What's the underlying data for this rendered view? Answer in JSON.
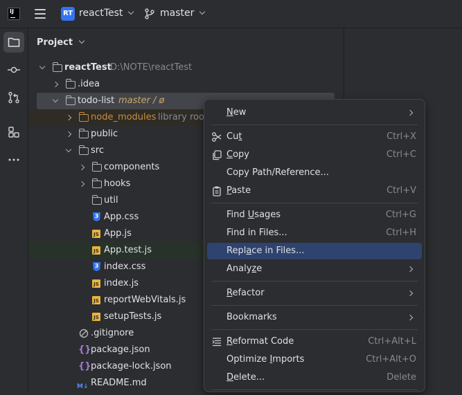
{
  "titlebar": {
    "logo": "IJ",
    "project_badge": "RT",
    "project_name": "reactTest",
    "branch": "master",
    "icons": [
      "intellij-logo-icon",
      "hamburger-menu-icon",
      "branch-icon",
      "chevron-down-icon"
    ]
  },
  "left_strip": {
    "icons": [
      "folder-icon",
      "commit-icon",
      "pull-request-icon",
      "structure-icon",
      "more-icon"
    ]
  },
  "panel": {
    "title": "Project"
  },
  "tree": {
    "root_name": "reactTest",
    "root_path": "D:\\NOTE\\reactTest",
    "idea": ".idea",
    "todo_list": "todo-list",
    "todo_branch": "master / ø",
    "node_modules": "node_modules",
    "node_modules_hint": "library root",
    "public": "public",
    "src": "src",
    "components": "components",
    "hooks": "hooks",
    "util": "util",
    "app_css": "App.css",
    "app_js": "App.js",
    "app_test_js": "App.test.js",
    "index_css": "index.css",
    "index_js": "index.js",
    "report_web_vitals": "reportWebVitals.js",
    "setup_tests": "setupTests.js",
    "gitignore": ".gitignore",
    "package_json": "package.json",
    "package_lock": "package-lock.json",
    "readme": "README.md",
    "badge_js": "JS",
    "badge_css": "3",
    "badge_md": "M↓",
    "badge_json": "{}"
  },
  "context_menu": {
    "new_a": "N",
    "new_b": "ew",
    "cut_a": "Cu",
    "cut_b": "t",
    "cut_shortcut": "Ctrl+X",
    "copy_a": "C",
    "copy_b": "opy",
    "copy_shortcut": "Ctrl+C",
    "copy_path": "Copy Path/Reference...",
    "paste_a": "P",
    "paste_b": "aste",
    "paste_shortcut": "Ctrl+V",
    "find_usages_a": "Find ",
    "find_usages_b": "U",
    "find_usages_c": "sages",
    "find_usages_shortcut": "Ctrl+G",
    "find_in_files": "Find in Files...",
    "find_in_files_shortcut": "Ctrl+H",
    "replace_a": "Repl",
    "replace_b": "a",
    "replace_c": "ce in Files...",
    "analyze_a": "Analy",
    "analyze_b": "z",
    "analyze_c": "e",
    "refactor_a": "R",
    "refactor_b": "efactor",
    "bookmarks": "Bookmarks",
    "reformat_a": "R",
    "reformat_b": "eformat Code",
    "reformat_shortcut": "Ctrl+Alt+L",
    "optimize_a": "Optimize ",
    "optimize_b": "I",
    "optimize_c": "mports",
    "optimize_shortcut": "Ctrl+Alt+O",
    "delete_a": "D",
    "delete_b": "elete...",
    "delete_shortcut": "Delete"
  },
  "colors": {
    "background": "#2b2d30",
    "highlight": "#2e436e",
    "selection": "#43454a",
    "accent": "#3574f0",
    "folder_excluded": "#c78e3e"
  }
}
